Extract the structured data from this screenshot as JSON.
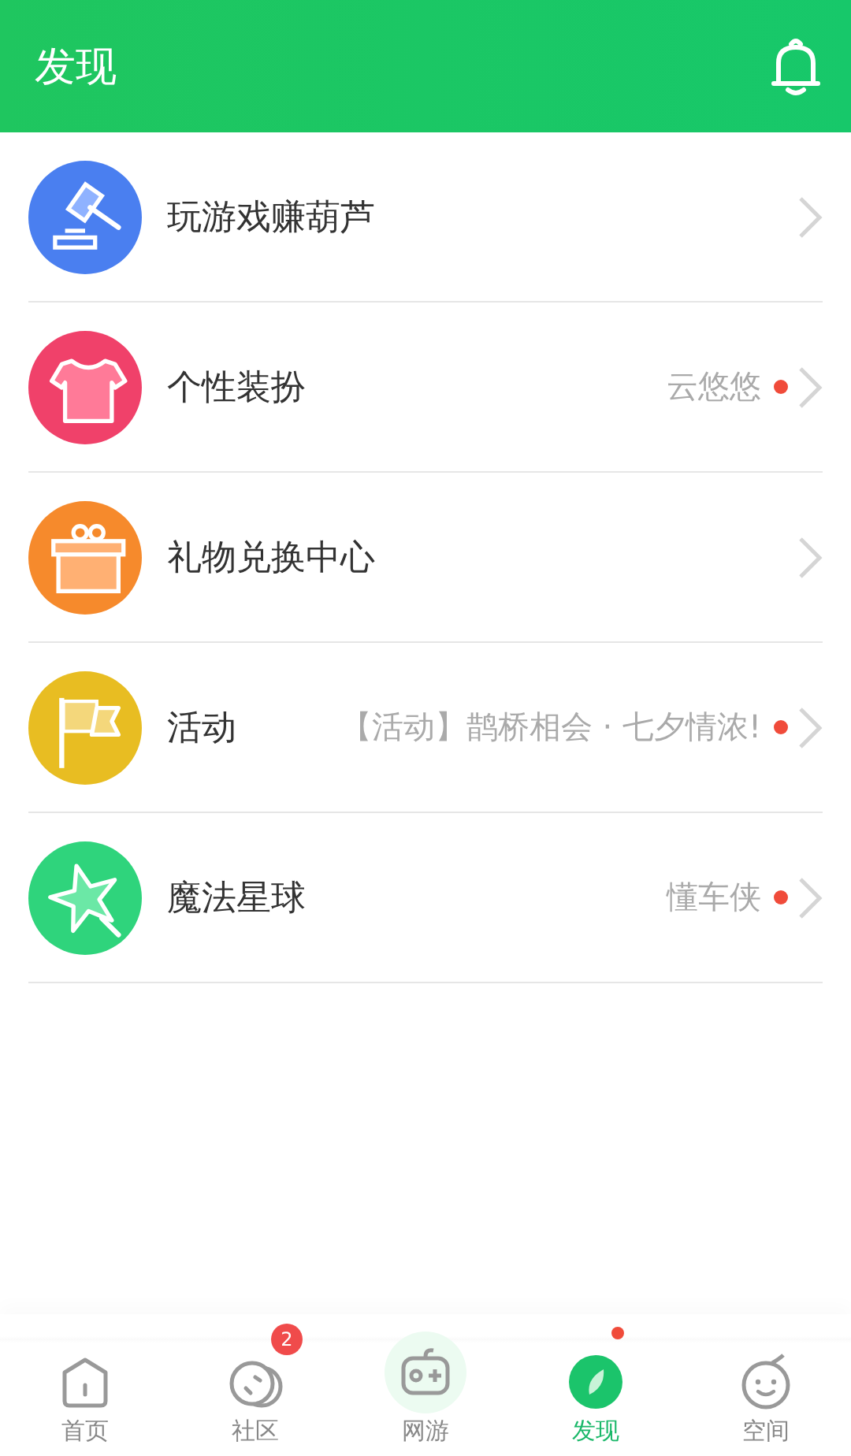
{
  "header": {
    "title": "发现"
  },
  "items": [
    {
      "kind": "gavel",
      "color": "#4a7ff0",
      "title": "玩游戏赚葫芦",
      "unread": false
    },
    {
      "kind": "shirt",
      "color": "#f0416a",
      "title": "个性装扮",
      "subtitle": "云悠悠",
      "unread": true
    },
    {
      "kind": "gift",
      "color": "#f68a2c",
      "title": "礼物兑换中心",
      "unread": false
    },
    {
      "kind": "flag",
      "color": "#e8bd22",
      "title": "活动",
      "subtitle": "【活动】鹊桥相会 · 七夕情浓!",
      "unread": true
    },
    {
      "kind": "star",
      "color": "#2fd47c",
      "title": "魔法星球",
      "subtitle": "懂车侠",
      "unread": true
    }
  ],
  "tabs": [
    {
      "kind": "home",
      "label": "首页",
      "selected": false,
      "unread": false
    },
    {
      "kind": "community",
      "label": "社区",
      "selected": false,
      "badge": "2",
      "unread": false
    },
    {
      "kind": "game",
      "label": "网游",
      "selected": false,
      "unread": false
    },
    {
      "kind": "discover",
      "label": "发现",
      "selected": true,
      "unread": true
    },
    {
      "kind": "space",
      "label": "空间",
      "selected": false,
      "unread": false
    }
  ]
}
